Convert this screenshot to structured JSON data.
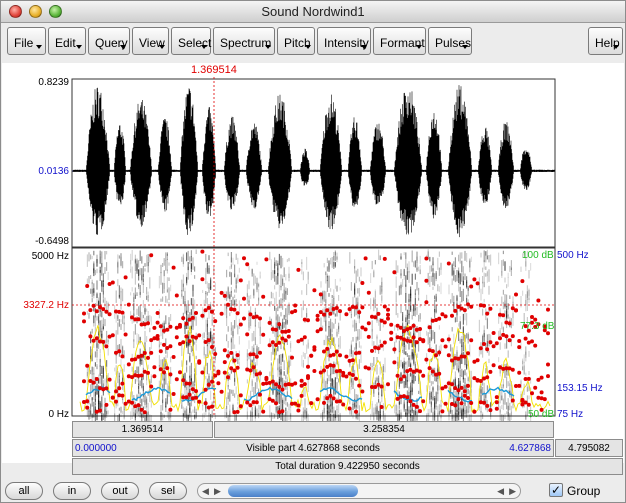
{
  "window": {
    "title": "Sound Nordwind1"
  },
  "menus": [
    "File",
    "Edit",
    "Query",
    "View",
    "Select",
    "Spectrum",
    "Pitch",
    "Intensity",
    "Formant",
    "Pulses"
  ],
  "help_label": "Help",
  "cursor_time": "1.369514",
  "waveform": {
    "max": "0.8239",
    "mid": "0.0136",
    "min": "-0.6498"
  },
  "spectrogram": {
    "left_top": "5000 Hz",
    "left_cursor": "3327.2 Hz",
    "left_bottom": "0 Hz",
    "intensity_top": "100 dB",
    "intensity_mid": "77.3 dB",
    "intensity_bottom": "50 dB",
    "pitch_top": "500 Hz",
    "pitch_value": "153.15 Hz",
    "pitch_bottom": "75 Hz"
  },
  "time_bars": {
    "left_segment": "1.369514",
    "right_segment": "3.258354",
    "visible_start": "0.000000",
    "visible_label": "Visible part 4.627868 seconds",
    "visible_end": "4.627868",
    "remaining": "4.795082",
    "total_label": "Total duration 9.422950 seconds"
  },
  "buttons": {
    "all": "all",
    "in": "in",
    "out": "out",
    "sel": "sel"
  },
  "group": {
    "label": "Group",
    "checked": true
  },
  "colors": {
    "cursor": "#e00000",
    "formant": "#e00000",
    "pitch": "#1a9ad8",
    "intensity": "#f2e000"
  }
}
